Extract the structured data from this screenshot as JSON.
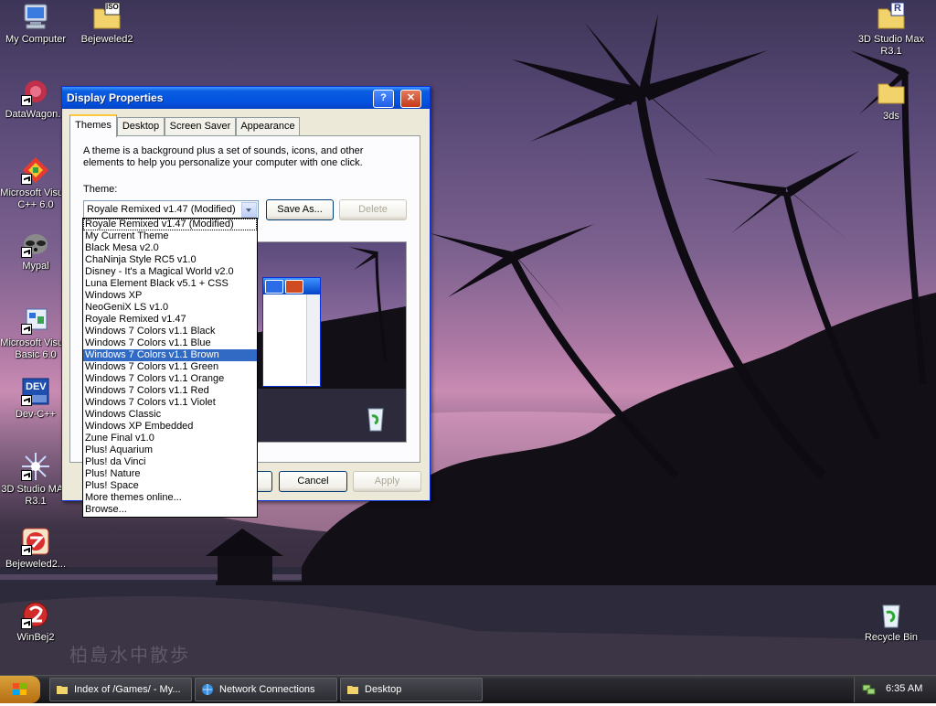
{
  "desktop": {
    "watermark": "柏島水中散歩",
    "icons": [
      {
        "label": "My Computer"
      },
      {
        "label": "Bejeweled2"
      },
      {
        "label": "DataWagon..."
      },
      {
        "label": "Microsoft Visual C++ 6.0"
      },
      {
        "label": "Mypal"
      },
      {
        "label": "Microsoft Visual Basic 6.0"
      },
      {
        "label": "Dev-C++"
      },
      {
        "label": "3D Studio MAX R3.1"
      },
      {
        "label": "Bejeweled2..."
      },
      {
        "label": "WinBej2"
      },
      {
        "label": "3D Studio Max R3.1"
      },
      {
        "label": "3ds"
      },
      {
        "label": "Recycle Bin"
      }
    ],
    "iso_badge": "ISO",
    "r_badge": "R",
    "dev_badge": "DEV"
  },
  "dialog": {
    "title": "Display Properties",
    "help": "?",
    "close": "✕",
    "tabs": [
      {
        "label": "Themes"
      },
      {
        "label": "Desktop"
      },
      {
        "label": "Screen Saver"
      },
      {
        "label": "Appearance"
      }
    ],
    "description": "A theme is a background plus a set of sounds, icons, and other elements to help you personalize your computer with one click.",
    "theme_label": "Theme:",
    "selected_theme": "Royale Remixed v1.47 (Modified)",
    "save_as": "Save As...",
    "delete": "Delete",
    "cancel": "Cancel",
    "apply": "Apply",
    "theme_options": [
      "Royale Remixed v1.47 (Modified)",
      "My Current Theme",
      "Black Mesa v2.0",
      "ChaNinja Style RC5 v1.0",
      "Disney - It's a Magical World v2.0",
      "Luna Element Black v5.1 + CSS",
      "Windows XP",
      "NeoGeniX LS v1.0",
      "Royale Remixed v1.47",
      "Windows 7 Colors v1.1 Black",
      "Windows 7 Colors v1.1 Blue",
      "Windows 7 Colors v1.1 Brown",
      "Windows 7 Colors v1.1 Green",
      "Windows 7 Colors v1.1 Orange",
      "Windows 7 Colors v1.1 Red",
      "Windows 7 Colors v1.1 Violet",
      "Windows Classic",
      "Windows XP Embedded",
      "Zune Final v1.0",
      "Plus! Aquarium",
      "Plus! da Vinci",
      "Plus! Nature",
      "Plus! Space",
      "More themes online...",
      "Browse..."
    ],
    "highlighted_option": "Windows 7 Colors v1.1 Brown"
  },
  "taskbar": {
    "tasks": [
      {
        "label": "Index of /Games/ - My..."
      },
      {
        "label": "Network Connections"
      },
      {
        "label": "Desktop"
      }
    ],
    "clock": "6:35 AM"
  }
}
